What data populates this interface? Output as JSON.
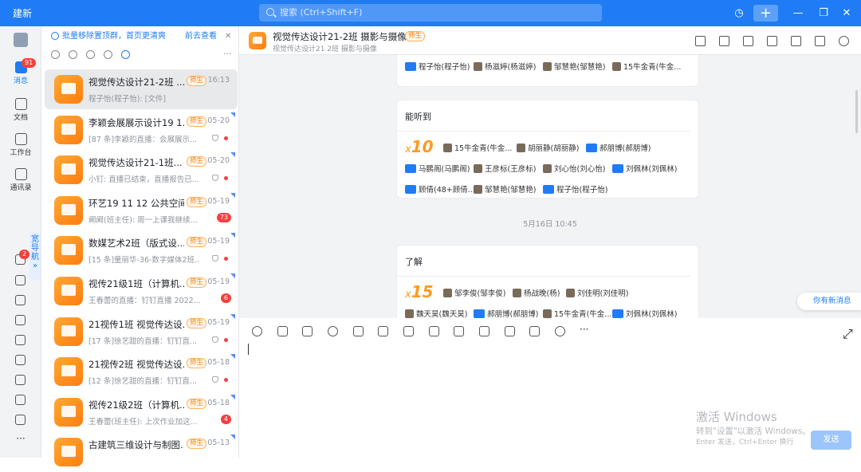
{
  "app": {
    "title": "建新"
  },
  "search": {
    "placeholder": "搜索 (Ctrl+Shift+F)"
  },
  "topbar": {
    "plus": "+",
    "minimize": "—",
    "restore": "❐",
    "close": "✕",
    "history": "◷"
  },
  "rail": {
    "messages": {
      "label": "消息",
      "badge": "91"
    },
    "docs": {
      "label": "文档"
    },
    "workbench": {
      "label": "工作台"
    },
    "contacts": {
      "label": "通讯录"
    },
    "phone_badge": "2",
    "wide_nav": "宽导航 »",
    "more": "···"
  },
  "notice": {
    "text": "批量移除置顶群，首页更清爽",
    "later": "前去查看",
    "close": "✕"
  },
  "filters": {
    "more": "···"
  },
  "conversations": [
    {
      "name": "视觉传达设计21-2班 ...",
      "tag": "师生",
      "time": "16:13",
      "preview": "程子怡(程子怡): [文件]"
    },
    {
      "name": "李颖会展展示设计19 1...",
      "tag": "师生",
      "time": "05-20",
      "preview": "[87 条]李颖的直播：会展展示..."
    },
    {
      "name": "视觉传达设计21-1班...",
      "tag": "师生",
      "time": "05-20",
      "preview": "小钉: 直播已结束，直播报告已..."
    },
    {
      "name": "环艺19 11 12 公共空间",
      "tag": "师生",
      "time": "05-19",
      "preview": "阚阚(班主任): 周一上课我继续...",
      "count": "73"
    },
    {
      "name": "数媒艺术2班（版式设...",
      "tag": "师生",
      "time": "05-19",
      "preview": "[15 条]童丽华-36-数字媒体2班..."
    },
    {
      "name": "视传21级1班（计算机...",
      "tag": "师生",
      "time": "05-19",
      "preview": "王春蕾的直播：钉钉直播 2022...",
      "count": "6"
    },
    {
      "name": "21视传1班 视觉传达设...",
      "tag": "师生",
      "time": "05-19",
      "preview": "[17 条]徐艺甜的直播：钉钉直..."
    },
    {
      "name": "21视传2班 视觉传达设...",
      "tag": "师生",
      "time": "05-18",
      "preview": "[12 条]徐艺甜的直播：钉钉直..."
    },
    {
      "name": "视传21级2班（计算机...",
      "tag": "师生",
      "time": "05-18",
      "preview": "王春蕾(班主任): 上次作业加这...",
      "count": "4"
    },
    {
      "name": "古建筑三维设计与制图...",
      "tag": "师生",
      "time": "05-13",
      "preview": ""
    }
  ],
  "chat": {
    "title": "视觉传达设计21-2班 摄影与摄像",
    "tag": "师生",
    "subtitle": "视觉传达设计21   2班 摄影与摄像",
    "card0": {
      "users": [
        "程子怡(程子怡)",
        "杨滋婷(杨滋婷)",
        "邹慧艳(邹慧艳)",
        "15牛金青(牛金..."
      ]
    },
    "card1": {
      "title": "能听到",
      "count": "10",
      "users": [
        "15牛金青(牛金...",
        "胡丽静(胡丽静)",
        "郝朋博(郝朋博)",
        "马鹏阁(马鹏阁)",
        "王彦标(王彦标)",
        "刘心怡(刘心怡)",
        "刘佩林(刘佩林)",
        "顾倩(48+顾倩...",
        "邹慧艳(邹慧艳)",
        "程子怡(程子怡)"
      ]
    },
    "date": "5月16日 10:45",
    "card2": {
      "title": "了解",
      "count": "15",
      "users": [
        "邹李俊(邹李俊)",
        "杨战晚(杨)",
        "刘佳明(刘佳明)",
        "魏天昊(魏天昊)",
        "郝朋博(郝朋博)",
        "15牛金青(牛金...",
        "刘佩林(刘佩林)"
      ]
    },
    "new_msg": "你有新消息",
    "watermark1": "激活 Windows",
    "watermark2": "转到\"设置\"以激活 Windows。",
    "hint": "Enter 发送，Ctrl+Enter 换行",
    "send": "发送",
    "tool_more": "···"
  },
  "colors": {
    "brand": "#1f7cf5",
    "orange": "#ff9a1f",
    "badge": "#f53f3f"
  }
}
